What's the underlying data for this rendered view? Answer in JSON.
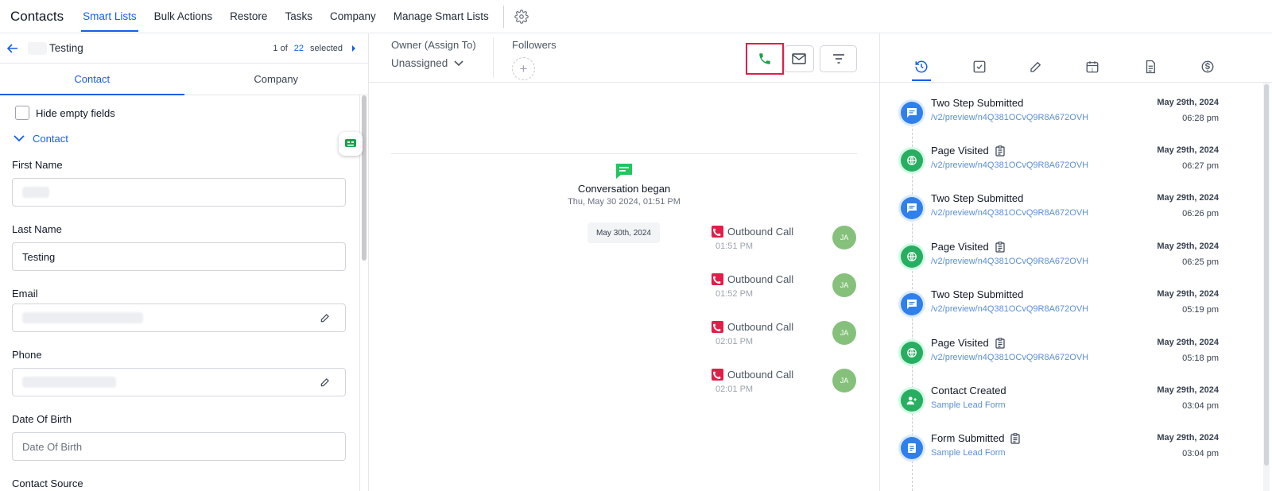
{
  "nav": {
    "title": "Contacts",
    "items": [
      {
        "label": "Smart Lists",
        "active": true
      },
      {
        "label": "Bulk Actions",
        "active": false
      },
      {
        "label": "Restore",
        "active": false
      },
      {
        "label": "Tasks",
        "active": false
      },
      {
        "label": "Company",
        "active": false
      },
      {
        "label": "Manage Smart Lists",
        "active": false
      }
    ],
    "settings_icon": "gear-icon"
  },
  "record": {
    "name": "Testing",
    "counter_prefix": "1 of",
    "counter_total": "22",
    "counter_suffix": "selected"
  },
  "left_tabs": [
    {
      "label": "Contact",
      "active": true
    },
    {
      "label": "Company",
      "active": false
    }
  ],
  "form": {
    "hide_empty_label": "Hide empty fields",
    "section_label": "Contact",
    "first_name_label": "First Name",
    "last_name_label": "Last Name",
    "last_name_value": "Testing",
    "email_label": "Email",
    "phone_label": "Phone",
    "dob_label": "Date Of Birth",
    "dob_placeholder": "Date Of Birth",
    "contact_source_label": "Contact Source"
  },
  "owner": {
    "label": "Owner (Assign To)",
    "value": "Unassigned",
    "followers_label": "Followers"
  },
  "conversation": {
    "began_title": "Conversation began",
    "began_date": "Thu, May 30 2024, 01:51 PM",
    "date_chip": "May 30th, 2024",
    "calls": [
      {
        "label": "Outbound Call",
        "time": "01:51 PM",
        "avatar": "JA"
      },
      {
        "label": "Outbound Call",
        "time": "01:52 PM",
        "avatar": "JA"
      },
      {
        "label": "Outbound Call",
        "time": "02:01 PM",
        "avatar": "JA"
      },
      {
        "label": "Outbound Call",
        "time": "02:01 PM",
        "avatar": "JA"
      }
    ]
  },
  "activity_tabs": [
    "activity-icon",
    "task-icon",
    "note-icon",
    "calendar-icon",
    "document-icon",
    "dollar-icon"
  ],
  "timeline": [
    {
      "title": "Two Step Submitted",
      "sub": "/v2/preview/n4Q381OCvQ9R8A672OVH",
      "date": "May 29th, 2024",
      "time": "06:28 pm",
      "kind": "blue",
      "icon": "chat-icon",
      "clip": false
    },
    {
      "title": "Page Visited",
      "sub": "/v2/preview/n4Q381OCvQ9R8A672OVH",
      "date": "May 29th, 2024",
      "time": "06:27 pm",
      "kind": "green",
      "icon": "globe-icon",
      "clip": true
    },
    {
      "title": "Two Step Submitted",
      "sub": "/v2/preview/n4Q381OCvQ9R8A672OVH",
      "date": "May 29th, 2024",
      "time": "06:26 pm",
      "kind": "blue",
      "icon": "chat-icon",
      "clip": false
    },
    {
      "title": "Page Visited",
      "sub": "/v2/preview/n4Q381OCvQ9R8A672OVH",
      "date": "May 29th, 2024",
      "time": "06:25 pm",
      "kind": "green",
      "icon": "globe-icon",
      "clip": true
    },
    {
      "title": "Two Step Submitted",
      "sub": "/v2/preview/n4Q381OCvQ9R8A672OVH",
      "date": "May 29th, 2024",
      "time": "05:19 pm",
      "kind": "blue",
      "icon": "chat-icon",
      "clip": false
    },
    {
      "title": "Page Visited",
      "sub": "/v2/preview/n4Q381OCvQ9R8A672OVH",
      "date": "May 29th, 2024",
      "time": "05:18 pm",
      "kind": "green",
      "icon": "globe-icon",
      "clip": true
    },
    {
      "title": "Contact Created",
      "sub": "Sample Lead Form",
      "date": "May 29th, 2024",
      "time": "03:04 pm",
      "kind": "green",
      "icon": "user-plus-icon",
      "clip": false
    },
    {
      "title": "Form Submitted",
      "sub": "Sample Lead Form",
      "date": "May 29th, 2024",
      "time": "03:04 pm",
      "kind": "blue",
      "icon": "form-icon",
      "clip": true
    }
  ],
  "colors": {
    "accent": "#155eef",
    "call_red": "#e11d48",
    "call_green": "#16a34a",
    "avatar_green": "#86c17b"
  }
}
